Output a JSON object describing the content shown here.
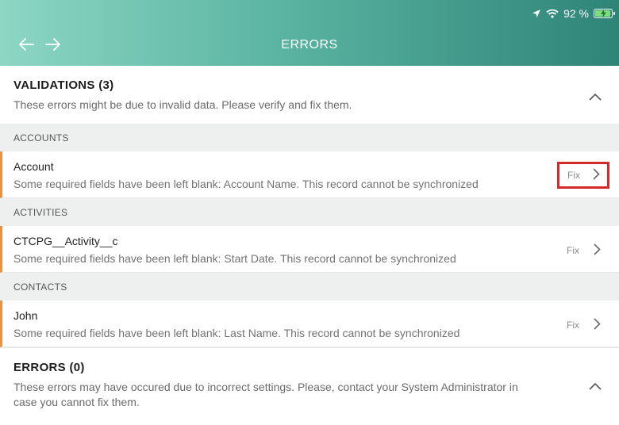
{
  "status_bar": {
    "battery_percent": "92 %",
    "battery_level": 0.92,
    "battery_charging": true
  },
  "header": {
    "title": "ERRORS"
  },
  "validations": {
    "title": "VALIDATIONS (3)",
    "description": "These errors might be due to invalid data. Please verify and fix them.",
    "groups": [
      {
        "name": "ACCOUNTS",
        "items": [
          {
            "title": "Account",
            "message": "Some required fields have been left blank: Account Name. This record cannot be synchronized",
            "action": "Fix"
          }
        ]
      },
      {
        "name": "ACTIVITIES",
        "items": [
          {
            "title": "CTCPG__Activity__c",
            "message": "Some required fields have been left blank: Start Date. This record cannot be synchronized",
            "action": "Fix"
          }
        ]
      },
      {
        "name": "CONTACTS",
        "items": [
          {
            "title": "John",
            "message": "Some required fields have been left blank: Last Name. This record cannot be synchronized",
            "action": "Fix"
          }
        ]
      }
    ]
  },
  "errors": {
    "title": "ERRORS (0)",
    "description": "These errors may have occured due to incorrect settings. Please, contact your System Administrator in case you cannot fix them."
  },
  "colors": {
    "header_gradient_start": "#8dd6c4",
    "header_gradient_end": "#2f8478",
    "row_accent": "#f0913a",
    "highlight": "#d42a2a",
    "group_background": "#eef0f0"
  },
  "icons": [
    "location-arrow-icon",
    "wifi-icon",
    "battery-charging-icon",
    "back-arrow-icon",
    "forward-arrow-icon",
    "chevron-up-icon",
    "chevron-right-icon"
  ]
}
